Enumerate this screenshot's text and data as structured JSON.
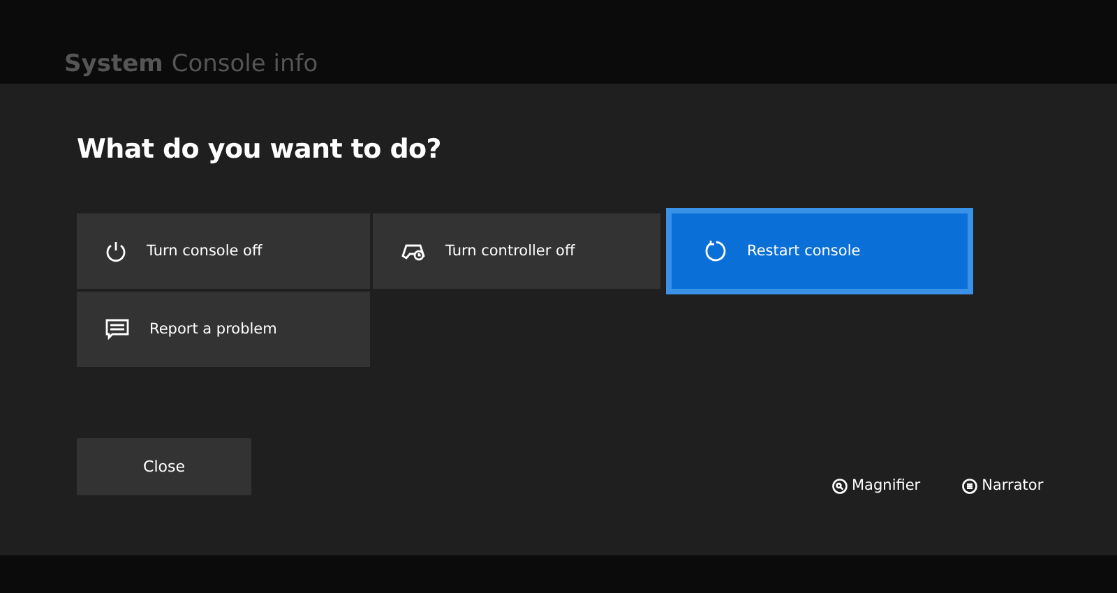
{
  "header": {
    "section": "System",
    "page": "Console info"
  },
  "dialog": {
    "title": "What do you want to do?",
    "options": [
      {
        "label": "Turn console off",
        "selected": false
      },
      {
        "label": "Turn controller off",
        "selected": false
      },
      {
        "label": "Restart console",
        "selected": true
      },
      {
        "label": "Report a problem",
        "selected": false
      }
    ],
    "close_button": "Close",
    "accessibility": [
      {
        "label": "Magnifier"
      },
      {
        "label": "Narrator"
      }
    ]
  }
}
